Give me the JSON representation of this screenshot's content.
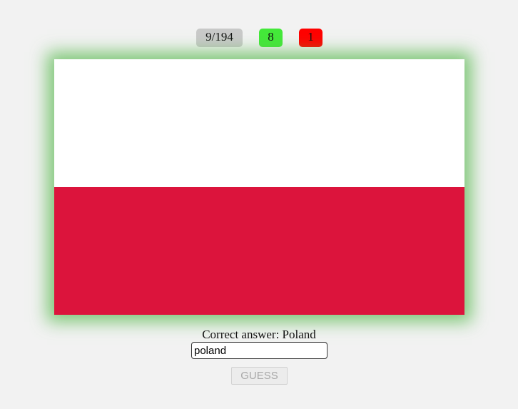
{
  "score": {
    "progress": "9/194",
    "correct_count": "8",
    "wrong_count": "1"
  },
  "flag": {
    "top_color": "#ffffff",
    "bottom_color": "#dc143c",
    "glow_color": "#5ab950"
  },
  "answer": {
    "text": "Correct answer: Poland"
  },
  "guess": {
    "value": "poland",
    "button_label": "GUESS"
  }
}
